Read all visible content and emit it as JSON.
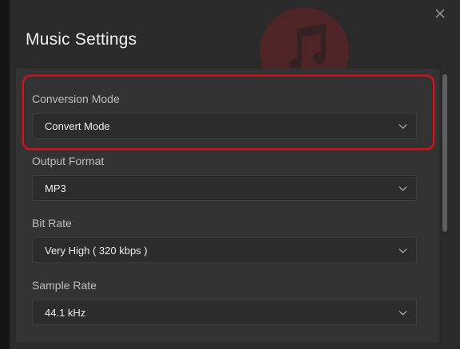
{
  "dialog": {
    "title": "Music Settings",
    "close_icon": "close-icon",
    "background_icon": "music-note-icon"
  },
  "fields": [
    {
      "label": "Conversion Mode",
      "value": "Convert Mode",
      "highlighted": true
    },
    {
      "label": "Output Format",
      "value": "MP3"
    },
    {
      "label": "Bit Rate",
      "value": "Very High ( 320 kbps )"
    },
    {
      "label": "Sample Rate",
      "value": "44.1 kHz"
    }
  ],
  "colors": {
    "background": "#2a2a2a",
    "panel": "#333333",
    "highlight": "#d6121c",
    "accent_disc": "#6b1f22"
  }
}
